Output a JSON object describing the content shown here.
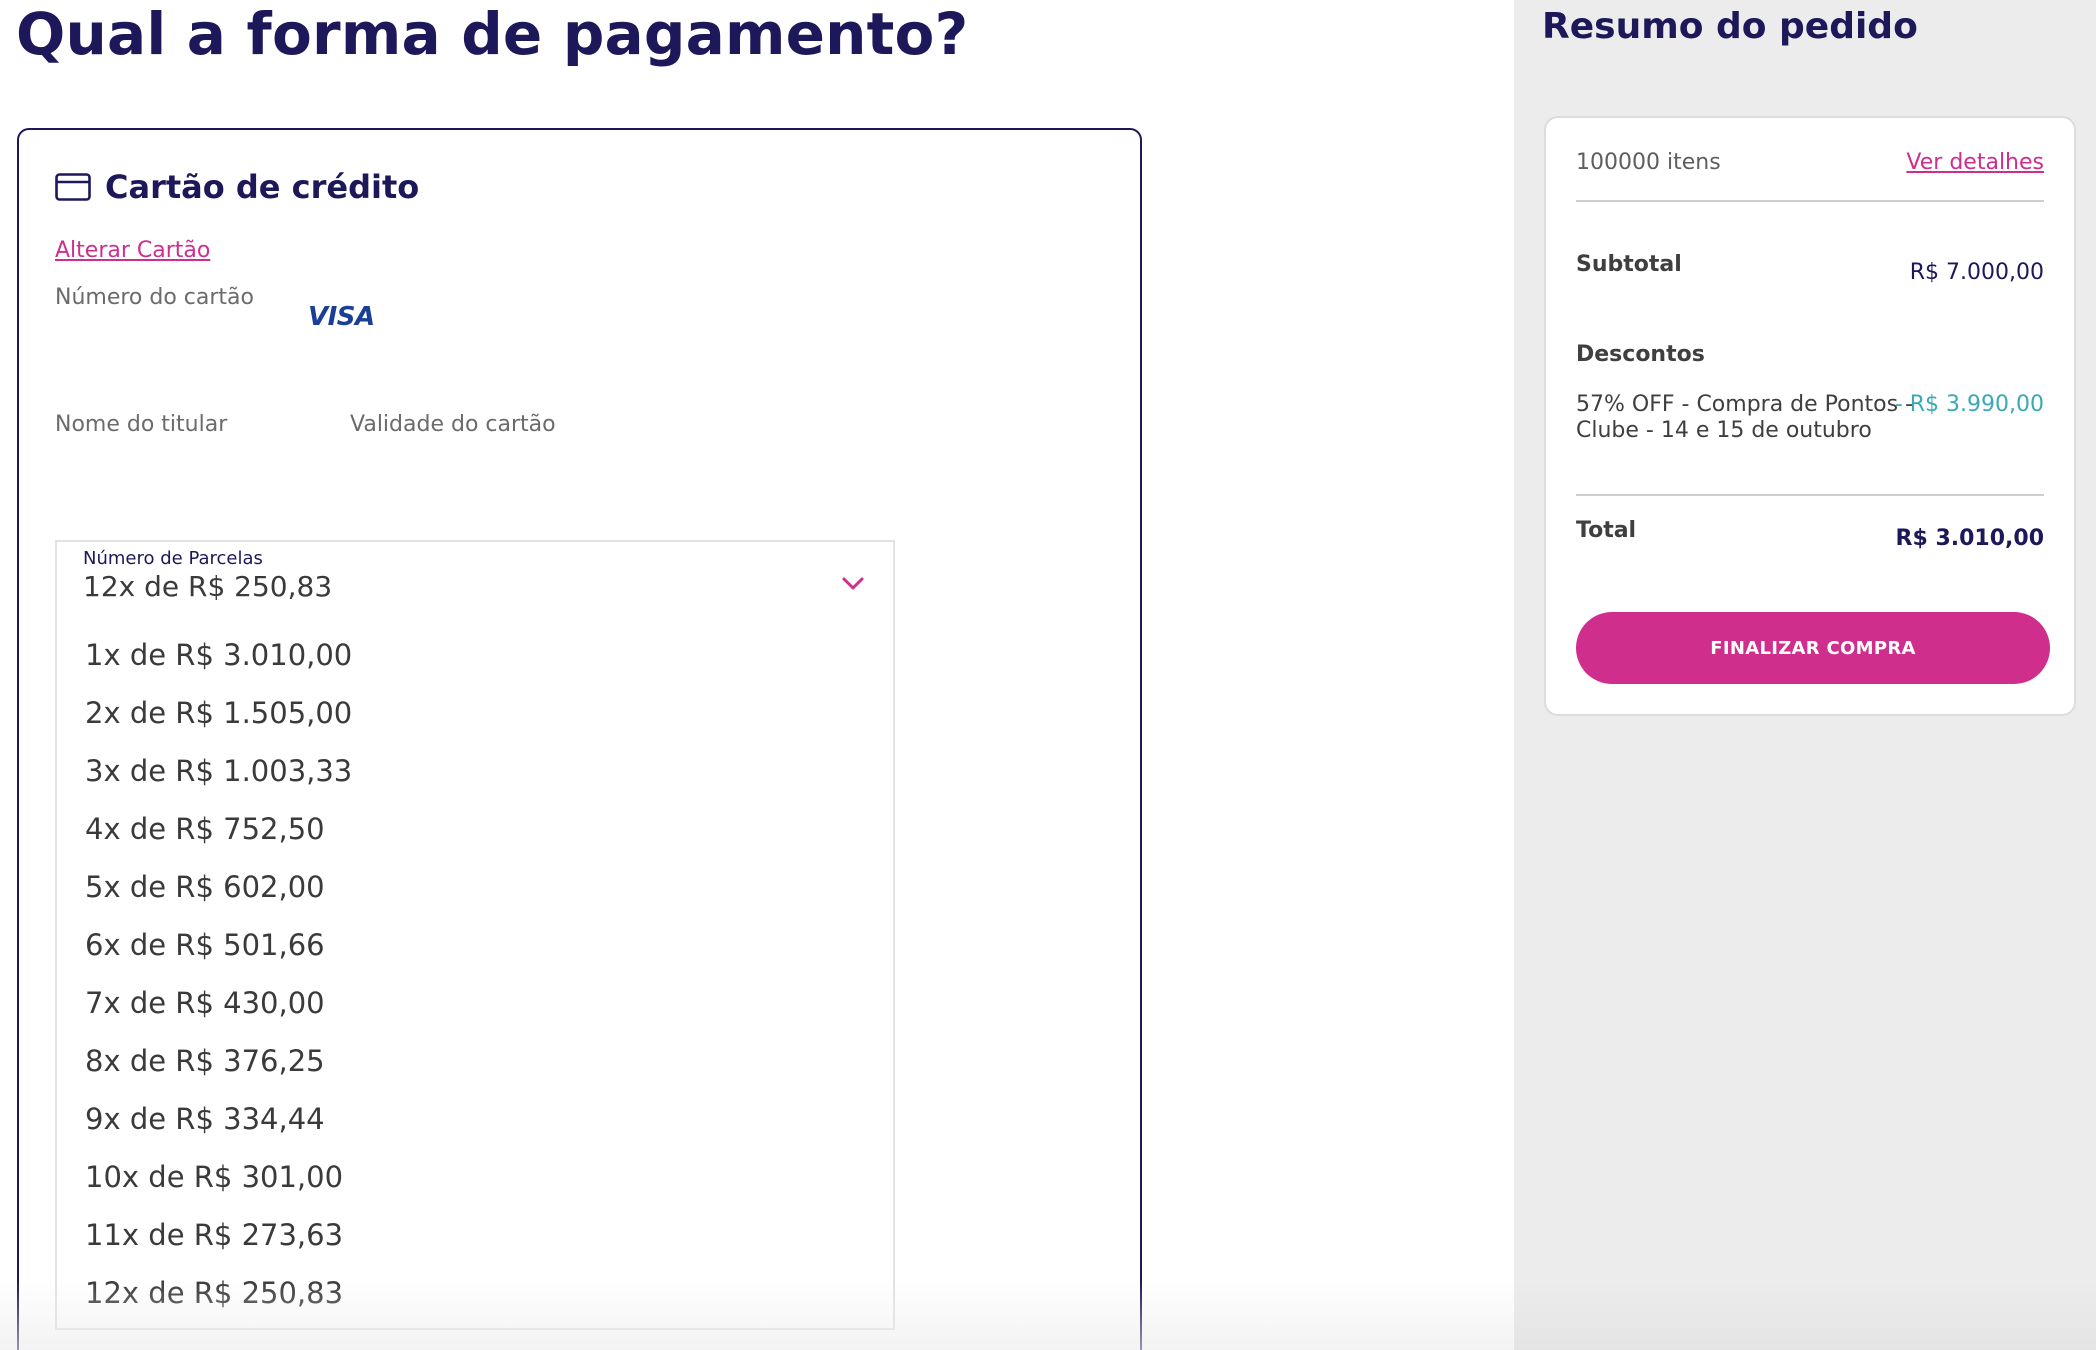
{
  "page": {
    "title": "Qual a forma de pagamento?"
  },
  "payment": {
    "method_icon": "credit-card-icon",
    "method_title": "Cartão de crédito",
    "change_card_link": "Alterar Cartão",
    "card_number_label": "Número do cartão",
    "card_brand": "VISA",
    "holder_name_label": "Nome do titular",
    "validity_label": "Validade do cartão",
    "installments": {
      "label": "Número de Parcelas",
      "selected": "12x de R$ 250,83",
      "chevron_icon": "chevron-down-icon",
      "options": [
        "1x de R$ 3.010,00",
        "2x de R$ 1.505,00",
        "3x de R$ 1.003,33",
        "4x de R$ 752,50",
        "5x de R$ 602,00",
        "6x de R$ 501,66",
        "7x de R$ 430,00",
        "8x de R$ 376,25",
        "9x de R$ 334,44",
        "10x de R$ 301,00",
        "11x de R$ 273,63",
        "12x de R$ 250,83"
      ]
    }
  },
  "summary": {
    "title": "Resumo do pedido",
    "items_count": "100000 itens",
    "details_link": "Ver detalhes",
    "subtotal_label": "Subtotal",
    "subtotal_value": "R$ 7.000,00",
    "discounts_label": "Descontos",
    "discount_description": "57% OFF - Compra de Pontos - Clube - 14 e 15 de outubro",
    "discount_value": "- R$ 3.990,00",
    "total_label": "Total",
    "total_value": "R$ 3.010,00",
    "finalize_button": "FINALIZAR COMPRA"
  },
  "colors": {
    "navy": "#1c1859",
    "accent_pink": "#cf2e8d",
    "discount_teal": "#3aa9b5",
    "sidebar_bg": "#ececec",
    "visa_blue": "#1a3f96"
  }
}
